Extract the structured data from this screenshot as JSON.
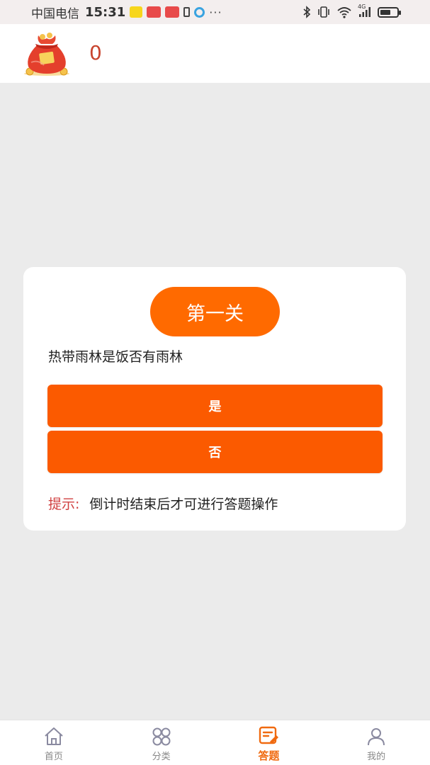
{
  "status_bar": {
    "carrier": "中国电信",
    "time": "15:31",
    "more": "···",
    "network": "4G",
    "battery_level": 0.65
  },
  "header": {
    "coin_count": "0"
  },
  "quiz": {
    "level_title": "第一关",
    "question": "热带雨林是饭否有雨林",
    "answers": [
      {
        "label": "是"
      },
      {
        "label": "否"
      }
    ],
    "hint_label": "提示:",
    "hint_text": "倒计时结束后才可进行答题操作"
  },
  "bottom_nav": {
    "items": [
      {
        "label": "首页",
        "icon": "home-icon"
      },
      {
        "label": "分类",
        "icon": "category-icon"
      },
      {
        "label": "答题",
        "icon": "quiz-icon",
        "active": true
      },
      {
        "label": "我的",
        "icon": "profile-icon"
      }
    ]
  },
  "colors": {
    "accent": "#fb5a00",
    "badge": "#ff6a00",
    "hint": "#d04040",
    "coin": "#c8442e",
    "nav_active": "#f06a10"
  }
}
